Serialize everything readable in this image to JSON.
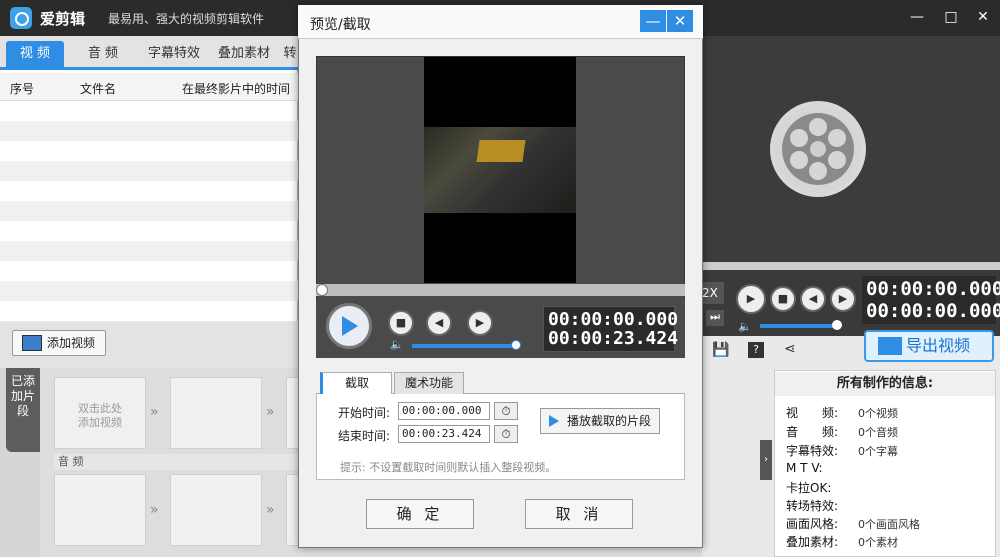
{
  "app": {
    "name": "爱剪辑",
    "slogan": "最易用、强大的视频剪辑软件"
  },
  "window_controls": {
    "minimize": "—",
    "maximize": "□",
    "close": "✕"
  },
  "tabs": [
    {
      "label": "视 频",
      "active": true
    },
    {
      "label": "音 频",
      "active": false
    },
    {
      "label": "字幕特效",
      "active": false
    },
    {
      "label": "叠加素材",
      "active": false
    },
    {
      "label": "转",
      "active": false
    }
  ],
  "clip_list": {
    "columns": [
      "序号",
      "文件名",
      "在最终影片中的时间"
    ]
  },
  "add_video_button": "添加视频",
  "track": {
    "label": "已添加片段",
    "first_slot_hint": "双击此处\n添加视频",
    "audio_label": "音 频"
  },
  "right_preview": {
    "speed": "2X",
    "time_current": "00:00:00.000",
    "time_total": "00:00:00.000"
  },
  "export_button": "导出视频",
  "info_panel": {
    "title": "所有制作的信息:",
    "items": [
      {
        "key": "视　　频:",
        "value": "0个视频"
      },
      {
        "key": "音　　频:",
        "value": "0个音频"
      },
      {
        "key": "字幕特效:",
        "value": "0个字幕"
      },
      {
        "key": "M T V:",
        "value": ""
      },
      {
        "key": "卡拉OK:",
        "value": ""
      },
      {
        "key": "转场特效:",
        "value": ""
      },
      {
        "key": "画面风格:",
        "value": "0个画面风格"
      },
      {
        "key": "叠加素材:",
        "value": "0个素材"
      }
    ]
  },
  "dialog": {
    "title": "预览/截取",
    "minimize": "—",
    "close": "✕",
    "time_current": "00:00:00.000",
    "time_total": "00:00:23.424",
    "sub_tabs": [
      "截取",
      "魔术功能"
    ],
    "start_label": "开始时间:",
    "start_value": "00:00:00.000",
    "end_label": "结束时间:",
    "end_value": "00:00:23.424",
    "play_segment": "播放截取的片段",
    "hint": "提示: 不设置截取时间则默认插入整段视频。",
    "ok": "确 定",
    "cancel": "取 消"
  },
  "colors": {
    "accent": "#2f8de4",
    "titlebar": "#2b2b2b"
  }
}
